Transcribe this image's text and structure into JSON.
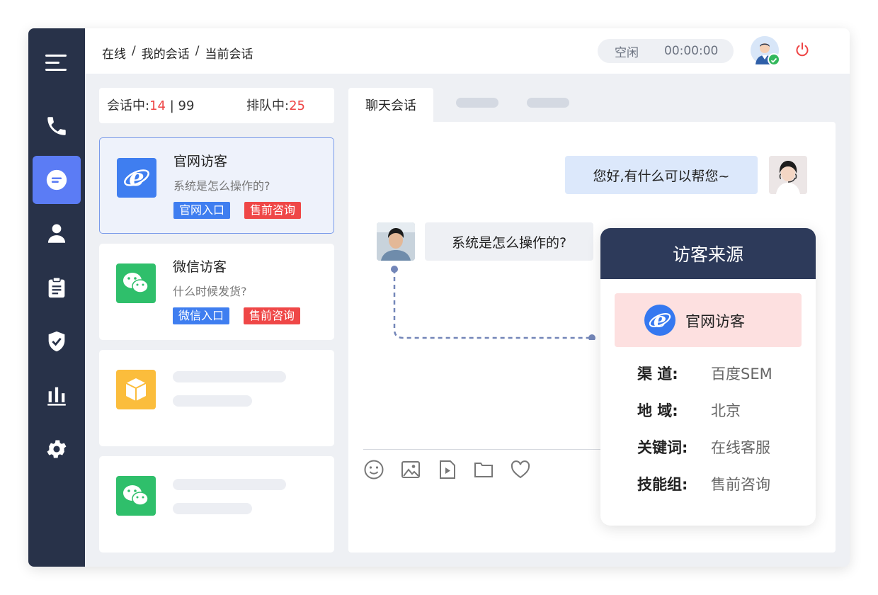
{
  "breadcrumb": [
    "在线",
    "我的会话",
    "当前会话"
  ],
  "status": {
    "state": "空闲",
    "timer": "00:00:00"
  },
  "stats": {
    "talking_label": "会话中:",
    "talking_count": "14",
    "talking_max": "99",
    "queue_label": "排队中:",
    "queue_count": "25"
  },
  "sessions": [
    {
      "title": "官网访客",
      "message": "系统是怎么操作的?",
      "tags": [
        "官网入口",
        "售前咨询"
      ],
      "icon": "ie-browser-icon",
      "color": "#3f7ef0"
    },
    {
      "title": "微信访客",
      "message": "什么时候发货?",
      "tags": [
        "微信入口",
        "售前咨询"
      ],
      "icon": "wechat-icon",
      "color": "#2fbf6b"
    }
  ],
  "chat": {
    "tab_label": "聊天会话",
    "messages": [
      {
        "from": "agent",
        "text": "您好,有什么可以帮您~"
      },
      {
        "from": "visitor",
        "text": "系统是怎么操作的?"
      }
    ]
  },
  "source_popup": {
    "title": "访客来源",
    "source_name": "官网访客",
    "rows": [
      {
        "key": "渠 道:",
        "value": "百度SEM"
      },
      {
        "key": "地 域:",
        "value": "北京"
      },
      {
        "key": "关键词:",
        "value": "在线客服"
      },
      {
        "key": "技能组:",
        "value": "售前咨询"
      }
    ]
  },
  "colors": {
    "sidebar": "#283249",
    "accent": "#5b7cf5",
    "danger": "#ee4444",
    "popup_header": "#2d3a5a"
  }
}
